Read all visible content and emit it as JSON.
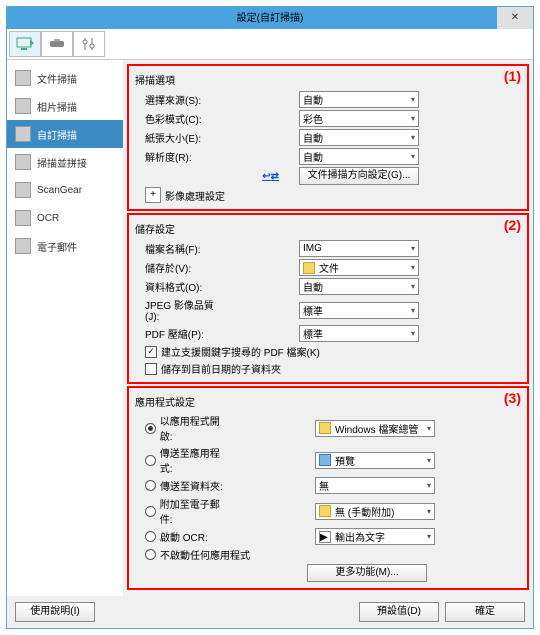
{
  "window": {
    "title": "設定(自訂掃描)"
  },
  "sidebar": {
    "items": [
      {
        "label": "文件掃描"
      },
      {
        "label": "相片掃描"
      },
      {
        "label": "自訂掃描"
      },
      {
        "label": "掃描並拼接"
      },
      {
        "label": "ScanGear"
      },
      {
        "label": "OCR"
      },
      {
        "label": "電子郵件"
      }
    ]
  },
  "region_labels": {
    "r1": "(1)",
    "r2": "(2)",
    "r3": "(3)"
  },
  "scan_options": {
    "title": "掃描選項",
    "source_label": "選擇來源(S):",
    "source_value": "自動",
    "color_label": "色彩模式(C):",
    "color_value": "彩色",
    "paper_label": "紙張大小(E):",
    "paper_value": "自動",
    "res_label": "解析度(R):",
    "res_value": "自動",
    "orient_btn": "文件掃描方向設定(G)...",
    "imgproc_label": "影像處理設定"
  },
  "save_settings": {
    "title": "儲存設定",
    "fname_label": "檔案名稱(F):",
    "fname_value": "IMG",
    "savein_label": "儲存於(V):",
    "savein_value": "文件",
    "format_label": "資料格式(O):",
    "format_value": "自動",
    "jpeg_label": "JPEG 影像品質(J):",
    "jpeg_value": "標準",
    "pdf_label": "PDF 壓縮(P):",
    "pdf_value": "標準",
    "chk1_label": "建立支援關鍵字搜尋的 PDF 檔案(K)",
    "chk2_label": "儲存到目前日期的子資料夾"
  },
  "app_settings": {
    "title": "應用程式設定",
    "r1_label": "以應用程式開啟:",
    "r1_value": "Windows 檔案總管",
    "r2_label": "傳送至應用程式:",
    "r2_value": "預覽",
    "r3_label": "傳送至資料夾:",
    "r3_value": "無",
    "r4_label": "附加至電子郵件:",
    "r4_value": "無 (手動附加)",
    "r5_label": "啟動 OCR:",
    "r5_value": "輸出為文字",
    "r6_label": "不啟動任何應用程式",
    "more_btn": "更多功能(M)..."
  },
  "footer": {
    "help": "使用說明(I)",
    "defaults": "預設值(D)",
    "ok": "確定"
  }
}
